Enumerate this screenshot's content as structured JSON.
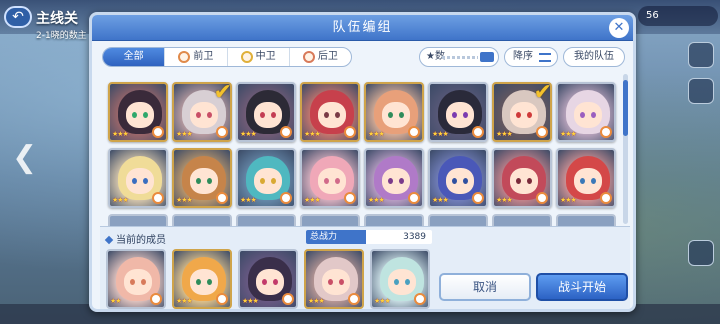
{
  "background": {
    "title": "主线关",
    "subtitle": "2-1晓的数主",
    "stamina": "56"
  },
  "dialog": {
    "title": "队伍编组",
    "close_icon": "close-icon"
  },
  "filters": {
    "tabs": [
      {
        "label": "全部",
        "active": true
      },
      {
        "label": "前卫",
        "active": false
      },
      {
        "label": "中卫",
        "active": false
      },
      {
        "label": "后卫",
        "active": false
      }
    ],
    "star_sort": "★数",
    "order": "降序",
    "my_team": "我的队伍"
  },
  "roster": [
    {
      "hair": "#3a2a3a",
      "bg": "#a86a6a",
      "eye": "#2fa86b",
      "stars": "★★★",
      "selected": false,
      "frame": "gold"
    },
    {
      "hair": "#d8cfd4",
      "bg": "#c9a6a8",
      "eye": "#c94f67",
      "stars": "★★★",
      "selected": true,
      "frame": "gold"
    },
    {
      "hair": "#2c2a36",
      "bg": "#7a5e79",
      "eye": "#c43d53",
      "stars": "★★★",
      "selected": false,
      "frame": "silver"
    },
    {
      "hair": "#c7404c",
      "bg": "#d67c6f",
      "eye": "#7a3a46",
      "stars": "★★★",
      "selected": false,
      "frame": "gold"
    },
    {
      "hair": "#e8a07a",
      "bg": "#e8b79a",
      "eye": "#2f8c5b",
      "stars": "★★★",
      "selected": false,
      "frame": "gold"
    },
    {
      "hair": "#2a2a3a",
      "bg": "#5c5a7a",
      "eye": "#7b3bb0",
      "stars": "★★★",
      "selected": false,
      "frame": "silver"
    },
    {
      "hair": "#d9c8c0",
      "bg": "#6c5a5e",
      "eye": "#cf3a3a",
      "stars": "★★★",
      "selected": true,
      "frame": "gold"
    },
    {
      "hair": "#e7d6e4",
      "bg": "#c9afc7",
      "eye": "#9a5fc0",
      "stars": "★★★",
      "selected": false,
      "frame": "silver"
    },
    {
      "hair": "#f0dc98",
      "bg": "#e6d3b3",
      "eye": "#3a6ec0",
      "stars": "★★★",
      "selected": false,
      "frame": "silver"
    },
    {
      "hair": "#c6844a",
      "bg": "#c9a06d",
      "eye": "#2f8c5b",
      "stars": "★★★",
      "selected": false,
      "frame": "gold"
    },
    {
      "hair": "#4fb8c0",
      "bg": "#6a8fb0",
      "eye": "#d9a933",
      "stars": "★★★",
      "selected": false,
      "frame": "silver"
    },
    {
      "hair": "#f0a8b8",
      "bg": "#e7b9c7",
      "eye": "#d16a8a",
      "stars": "★★★",
      "selected": false,
      "frame": "silver"
    },
    {
      "hair": "#b07ac8",
      "bg": "#c8a8cf",
      "eye": "#7a3a8a",
      "stars": "★★★",
      "selected": false,
      "frame": "silver"
    },
    {
      "hair": "#4a58b8",
      "bg": "#7784c4",
      "eye": "#2f4fa0",
      "stars": "★★★",
      "selected": false,
      "frame": "silver"
    },
    {
      "hair": "#c24a5a",
      "bg": "#d38a90",
      "eye": "#7a2a3a",
      "stars": "★★★",
      "selected": false,
      "frame": "silver"
    },
    {
      "hair": "#d44848",
      "bg": "#e09a9a",
      "eye": "#3a78b8",
      "stars": "★★★",
      "selected": false,
      "frame": "silver"
    }
  ],
  "members_panel": {
    "label": "当前的成员",
    "power_label": "总战力",
    "power_value": "3389",
    "members": [
      {
        "hair": "#f0b8a8",
        "bg": "#f2d0c8",
        "eye": "#d87a5a",
        "stars": "★★",
        "frame": "silver"
      },
      {
        "hair": "#f0a84a",
        "bg": "#f1cf8f",
        "eye": "#2f8c5b",
        "stars": "★★★",
        "frame": "gold"
      },
      {
        "hair": "#3a2f4a",
        "bg": "#6e5a86",
        "eye": "#c33a6a",
        "stars": "★★★",
        "frame": "silver"
      },
      {
        "hair": "#e2c8c8",
        "bg": "#c6a09a",
        "eye": "#c94f67",
        "stars": "★★★",
        "frame": "gold"
      },
      {
        "hair": "#bfe4e0",
        "bg": "#d7ecf0",
        "eye": "#4aa0c0",
        "stars": "★★★",
        "frame": "silver"
      }
    ],
    "cancel_label": "取消",
    "start_label": "战斗开始"
  }
}
